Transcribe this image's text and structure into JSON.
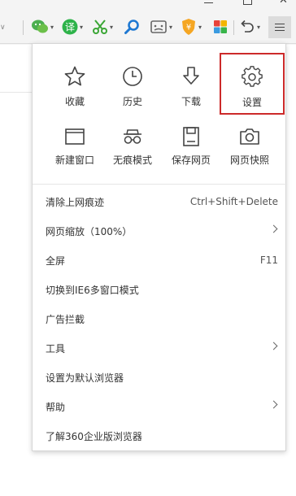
{
  "menu": {
    "quick_row1": [
      {
        "label": "收藏",
        "icon": "star-icon"
      },
      {
        "label": "历史",
        "icon": "clock-icon"
      },
      {
        "label": "下载",
        "icon": "download-icon"
      },
      {
        "label": "设置",
        "icon": "gear-icon"
      }
    ],
    "quick_row2": [
      {
        "label": "新建窗口",
        "icon": "new-window-icon"
      },
      {
        "label": "无痕模式",
        "icon": "incognito-icon"
      },
      {
        "label": "保存网页",
        "icon": "save-icon"
      },
      {
        "label": "网页快照",
        "icon": "camera-icon"
      }
    ],
    "items": [
      {
        "label": "清除上网痕迹",
        "shortcut": "Ctrl+Shift+Delete"
      },
      {
        "label": "网页缩放（100%）",
        "has_submenu": true
      },
      {
        "label": "全屏",
        "shortcut": "F11"
      },
      {
        "label": "切换到IE6多窗口模式"
      },
      {
        "label": "广告拦截"
      },
      {
        "label": "工具",
        "has_submenu": true
      },
      {
        "label": "设置为默认浏览器"
      },
      {
        "label": "帮助",
        "has_submenu": true
      },
      {
        "label": "了解360企业版浏览器"
      }
    ]
  },
  "colors": {
    "highlight_border": "#cc2a2a",
    "menu_button_bg": "#dcdcdc",
    "wechat_green": "#4caf50",
    "translate_green": "#2eb34a",
    "scissors_green": "#3aa635",
    "search_blue": "#1e78d2",
    "shield_orange": "#f5a623"
  }
}
